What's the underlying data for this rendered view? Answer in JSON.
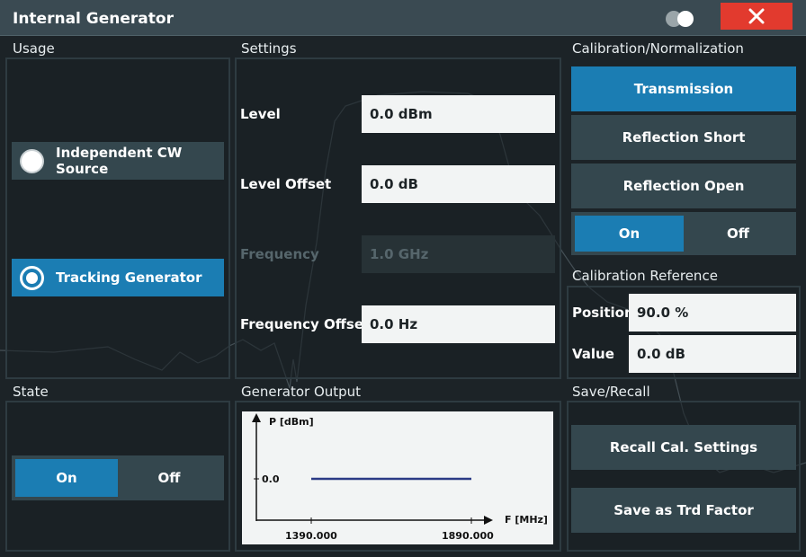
{
  "window": {
    "title": "Internal Generator",
    "close_icon": "close-icon",
    "toggle_icon": "toggle-icon"
  },
  "usage": {
    "label": "Usage",
    "options": [
      {
        "label": "Independent CW Source",
        "selected": false
      },
      {
        "label": "Tracking Generator",
        "selected": true
      }
    ]
  },
  "settings": {
    "label": "Settings",
    "level": {
      "label": "Level",
      "value": "0.0 dBm"
    },
    "level_offset": {
      "label": "Level Offset",
      "value": "0.0 dB"
    },
    "frequency": {
      "label": "Frequency",
      "value": "1.0 GHz",
      "enabled": false
    },
    "frequency_offset": {
      "label": "Frequency Offset",
      "value": "0.0 Hz"
    }
  },
  "calibration": {
    "label": "Calibration/Normalization",
    "buttons": [
      {
        "label": "Transmission",
        "active": true
      },
      {
        "label": "Reflection Short",
        "active": false
      },
      {
        "label": "Reflection Open",
        "active": false
      }
    ],
    "toggle": {
      "on_label": "On",
      "off_label": "Off",
      "state": "On"
    }
  },
  "calibration_reference": {
    "label": "Calibration Reference",
    "position": {
      "label": "Position",
      "value": "90.0 %"
    },
    "value": {
      "label": "Value",
      "value": "0.0 dB"
    }
  },
  "state": {
    "label": "State",
    "on_label": "On",
    "off_label": "Off",
    "state": "On"
  },
  "generator_output": {
    "label": "Generator Output",
    "y_axis_label": "P [dBm]",
    "x_axis_label": "F [MHz]",
    "y_tick": "0.0",
    "x_start": "1390.000",
    "x_stop": "1890.000",
    "line_color": "#2b3a85"
  },
  "save_recall": {
    "label": "Save/Recall",
    "recall_label": "Recall Cal. Settings",
    "save_label": "Save as Trd Factor"
  },
  "colors": {
    "accent": "#1b7db3",
    "close": "#e23a2e",
    "button": "#34474e",
    "background": "#1c2327"
  }
}
